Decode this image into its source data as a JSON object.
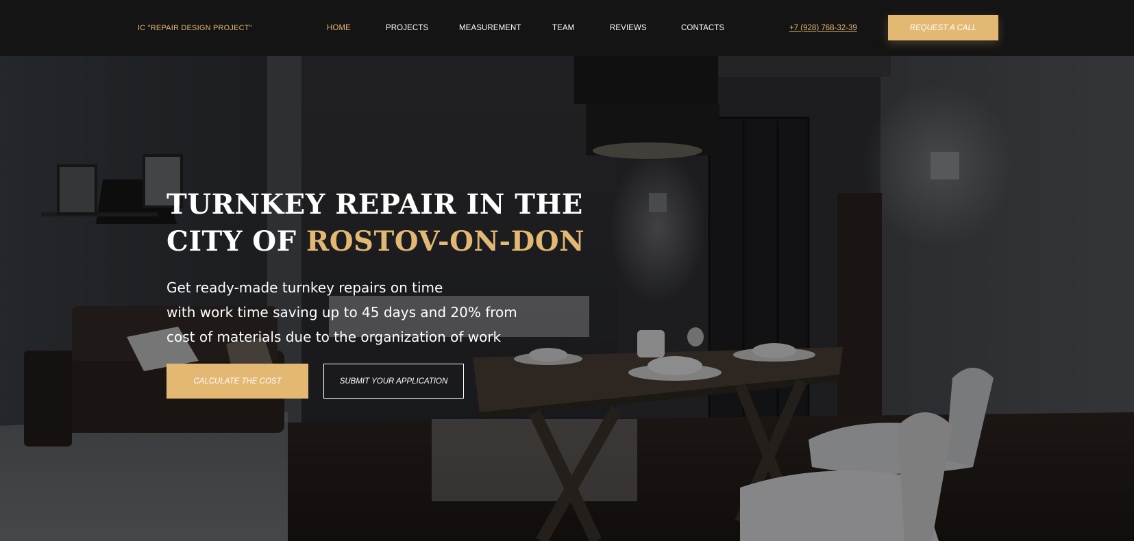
{
  "header": {
    "logo": "IC \"REPAIR DESIGN PROJECT\"",
    "nav": [
      {
        "label": "HOME",
        "active": true
      },
      {
        "label": "PROJECTS",
        "active": false
      },
      {
        "label": "MEASUREMENT",
        "active": false
      },
      {
        "label": "TEAM",
        "active": false
      },
      {
        "label": "REVIEWS",
        "active": false
      },
      {
        "label": "CONTACTS",
        "active": false
      }
    ],
    "phone": "+7 (928) 768-32-39",
    "call_button": "REQUEST A CALL"
  },
  "hero": {
    "title_line1": "TURNKEY REPAIR IN THE",
    "title_line2_prefix": "CITY OF ",
    "title_line2_accent": "ROSTOV-ON-DON",
    "subtitle_lines": [
      "Get ready-made turnkey repairs on time",
      "with work time saving up to 45 days and 20% from",
      "cost of materials due to the organization of work"
    ],
    "calc_button": "CALCULATE THE COST",
    "submit_button": "SUBMIT YOUR APPLICATION"
  },
  "colors": {
    "accent": "#e3b873",
    "header_bg": "#141414",
    "text": "#ffffff"
  }
}
